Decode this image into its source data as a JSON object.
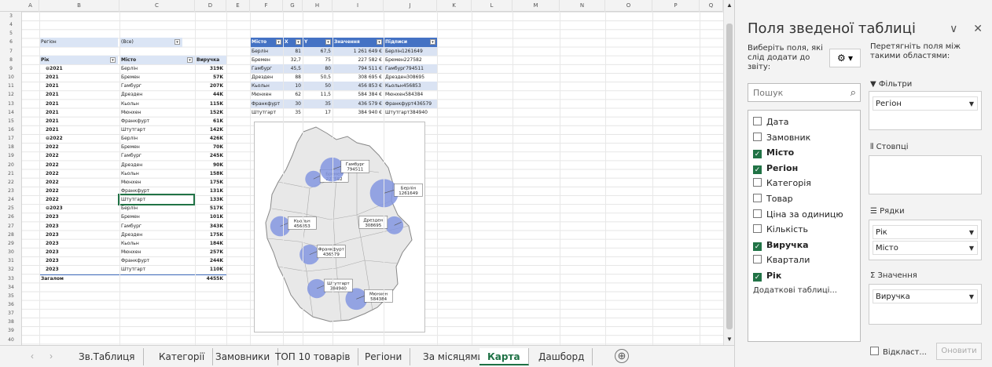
{
  "columns": [
    "A",
    "B",
    "C",
    "D",
    "E",
    "F",
    "G",
    "H",
    "I",
    "J",
    "K",
    "L",
    "M",
    "N",
    "O",
    "P",
    "Q"
  ],
  "row_numbers": [
    "3",
    "4",
    "5",
    "6",
    "7",
    "8",
    "9",
    "10",
    "11",
    "12",
    "13",
    "14",
    "15",
    "16",
    "17",
    "18",
    "19",
    "20",
    "21",
    "22",
    "23",
    "24",
    "25",
    "26",
    "27",
    "28",
    "29",
    "30",
    "31",
    "32",
    "33",
    "34",
    "35",
    "36",
    "37",
    "38",
    "39",
    "40"
  ],
  "pivot": {
    "filter_label": "Регіон",
    "filter_value": "(Все)",
    "header_year": "Рік",
    "header_city": "Місто",
    "header_revenue": "Виручка",
    "rows": [
      {
        "year": "⊖2021",
        "city": "Берлін",
        "val": "319K",
        "group": true
      },
      {
        "year": "2021",
        "city": "Бремен",
        "val": "57K"
      },
      {
        "year": "2021",
        "city": "Гамбург",
        "val": "207K"
      },
      {
        "year": "2021",
        "city": "Дрезден",
        "val": "44K"
      },
      {
        "year": "2021",
        "city": "Кьольн",
        "val": "115K"
      },
      {
        "year": "2021",
        "city": "Мюнхен",
        "val": "152K"
      },
      {
        "year": "2021",
        "city": "Франкфурт",
        "val": "61K"
      },
      {
        "year": "2021",
        "city": "Штутгарт",
        "val": "142K"
      },
      {
        "year": "⊖2022",
        "city": "Берлін",
        "val": "426K",
        "group": true
      },
      {
        "year": "2022",
        "city": "Бремен",
        "val": "70K"
      },
      {
        "year": "2022",
        "city": "Гамбург",
        "val": "245K"
      },
      {
        "year": "2022",
        "city": "Дрезден",
        "val": "90K"
      },
      {
        "year": "2022",
        "city": "Кьольн",
        "val": "158K"
      },
      {
        "year": "2022",
        "city": "Мюнхен",
        "val": "175K"
      },
      {
        "year": "2022",
        "city": "Франкфурт",
        "val": "131K"
      },
      {
        "year": "2022",
        "city": "Штутгарт",
        "val": "133K",
        "selected": true
      },
      {
        "year": "⊖2023",
        "city": "Берлін",
        "val": "517K",
        "group": true
      },
      {
        "year": "2023",
        "city": "Бремен",
        "val": "101K"
      },
      {
        "year": "2023",
        "city": "Гамбург",
        "val": "343K"
      },
      {
        "year": "2023",
        "city": "Дрезден",
        "val": "175K"
      },
      {
        "year": "2023",
        "city": "Кьольн",
        "val": "184K"
      },
      {
        "year": "2023",
        "city": "Мюнхен",
        "val": "257K"
      },
      {
        "year": "2023",
        "city": "Франкфурт",
        "val": "244K"
      },
      {
        "year": "2023",
        "city": "Штутгарт",
        "val": "110K"
      }
    ],
    "total_label": "Загалом",
    "total_value": "4455K"
  },
  "table": {
    "headers": [
      "Місто",
      "X",
      "Y",
      "Значення",
      "Підписи"
    ],
    "rows": [
      [
        "Берлін",
        "81",
        "67,5",
        "1 261 649 €",
        "Берлін1261649"
      ],
      [
        "Бремен",
        "32,7",
        "75",
        "227 582 €",
        "Бремен227582"
      ],
      [
        "Гамбург",
        "45,5",
        "80",
        "794 511 €",
        "Гамбург794511"
      ],
      [
        "Дрезден",
        "88",
        "50,5",
        "308 695 €",
        "Дрезден308695"
      ],
      [
        "Кьольн",
        "10",
        "50",
        "456 853 €",
        "Кьольн456853"
      ],
      [
        "Мюнхен",
        "62",
        "11,5",
        "584 384 €",
        "Мюнхен584384"
      ],
      [
        "Франкфурт",
        "30",
        "35",
        "436 579 €",
        "Франкфурт436579"
      ],
      [
        "Штутгарт",
        "35",
        "17",
        "384 940 €",
        "Штутгарт384940"
      ]
    ]
  },
  "chart_data": {
    "type": "scatter",
    "title": "",
    "xlim": [
      0,
      100
    ],
    "ylim": [
      0,
      100
    ],
    "points": [
      {
        "city": "Берлін",
        "x": 81,
        "y": 67.5,
        "value": 1261649,
        "label_city": "Берлін",
        "label_value": "1261649"
      },
      {
        "city": "Бремен",
        "x": 32.7,
        "y": 75,
        "value": 227582,
        "label_city": "Бремен",
        "label_value": "227582"
      },
      {
        "city": "Гамбург",
        "x": 45.5,
        "y": 80,
        "value": 794511,
        "label_city": "Гамбург",
        "label_value": "794511"
      },
      {
        "city": "Дрезден",
        "x": 88,
        "y": 50.5,
        "value": 308695,
        "label_city": "Дрезден",
        "label_value": "308695"
      },
      {
        "city": "Кьольн",
        "x": 10,
        "y": 50,
        "value": 456853,
        "label_city": "Кьольн",
        "label_value": "456853"
      },
      {
        "city": "Мюнхен",
        "x": 62,
        "y": 11.5,
        "value": 584384,
        "label_city": "Мюнхен",
        "label_value": "584384"
      },
      {
        "city": "Франкфурт",
        "x": 30,
        "y": 35,
        "value": 436579,
        "label_city": "Франкфурт",
        "label_value": "436579"
      },
      {
        "city": "Штутгарт",
        "x": 35,
        "y": 17,
        "value": 384940,
        "label_city": "Штутгарт",
        "label_value": "384940"
      }
    ],
    "bubble_color": "#8497e0"
  },
  "tabs": {
    "items": [
      "Зв.Таблиця",
      "Категорії",
      "Замовники",
      "ТОП 10 товарів",
      "Регіони",
      "За місяцями",
      "Карта",
      "Дашборд"
    ],
    "active": "Карта",
    "add_symbol": "⊕",
    "prev": "‹",
    "next": "›"
  },
  "pane": {
    "title": "Поля зведеної таблиці",
    "collapse": "∨",
    "close": "✕",
    "choose_text": "Виберіть поля, які слід додати до звіту:",
    "drag_text": "Перетягніть поля між такими областями:",
    "gear": "⚙ ▾",
    "search_placeholder": "Пошук",
    "fields": [
      {
        "label": "Дата",
        "checked": false
      },
      {
        "label": "Замовник",
        "checked": false
      },
      {
        "label": "Місто",
        "checked": true
      },
      {
        "label": "Регіон",
        "checked": true
      },
      {
        "label": "Категорія",
        "checked": false
      },
      {
        "label": "Товар",
        "checked": false
      },
      {
        "label": "Ціна за одиницю",
        "checked": false
      },
      {
        "label": "Кількість",
        "checked": false
      },
      {
        "label": "Виручка",
        "checked": true
      },
      {
        "label": "Квартали",
        "checked": false
      },
      {
        "label": "Рік",
        "checked": true
      }
    ],
    "more_tables": "Додаткові таблиці...",
    "filters_label": "Фільтри",
    "filters_items": [
      "Регіон"
    ],
    "columns_label": "Стовпці",
    "rows_label": "Рядки",
    "rows_items": [
      "Рік",
      "Місто"
    ],
    "values_label": "Значення",
    "values_items": [
      "Виручка"
    ],
    "defer_label": "Відкласт...",
    "update_label": "Оновити",
    "accent_color": "#217346"
  }
}
